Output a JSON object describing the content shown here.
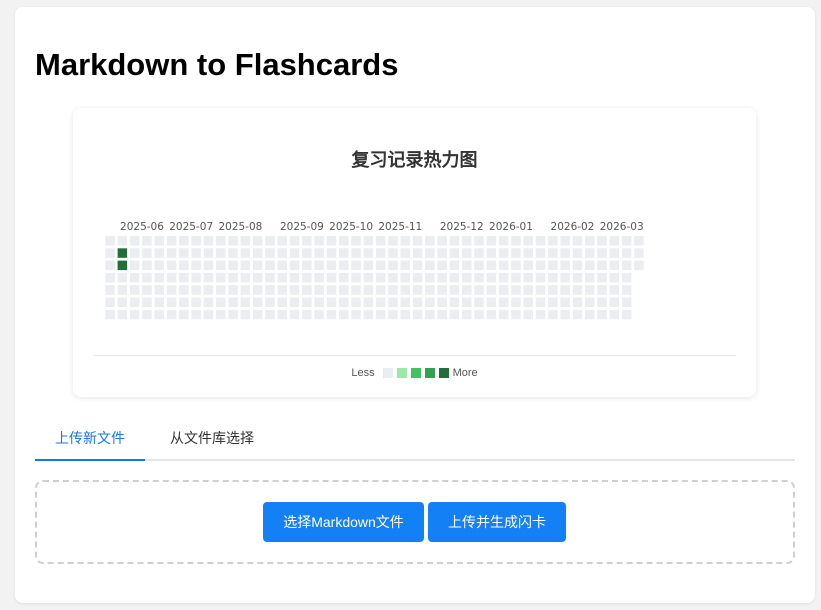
{
  "page": {
    "title": "Markdown to Flashcards"
  },
  "heatmap": {
    "title": "复习记录热力图",
    "months": [
      "2025-06",
      "2025-07",
      "2025-08",
      "2025-09",
      "2025-10",
      "2025-11",
      "2025-12",
      "2026-01",
      "2026-02",
      "2026-03"
    ],
    "legend": {
      "less": "Less",
      "more": "More",
      "colors": [
        "#ebedf0",
        "#9be9a8",
        "#40c463",
        "#30a14e",
        "#216e39"
      ]
    },
    "active_days": [
      {
        "week": 2,
        "weekday": 1,
        "level": 4
      },
      {
        "week": 2,
        "weekday": 2,
        "level": 4
      }
    ]
  },
  "tabs": [
    {
      "label": "上传新文件",
      "active": true
    },
    {
      "label": "从文件库选择",
      "active": false
    }
  ],
  "buttons": {
    "select_file": "选择Markdown文件",
    "upload_generate": "上传并生成闪卡"
  }
}
